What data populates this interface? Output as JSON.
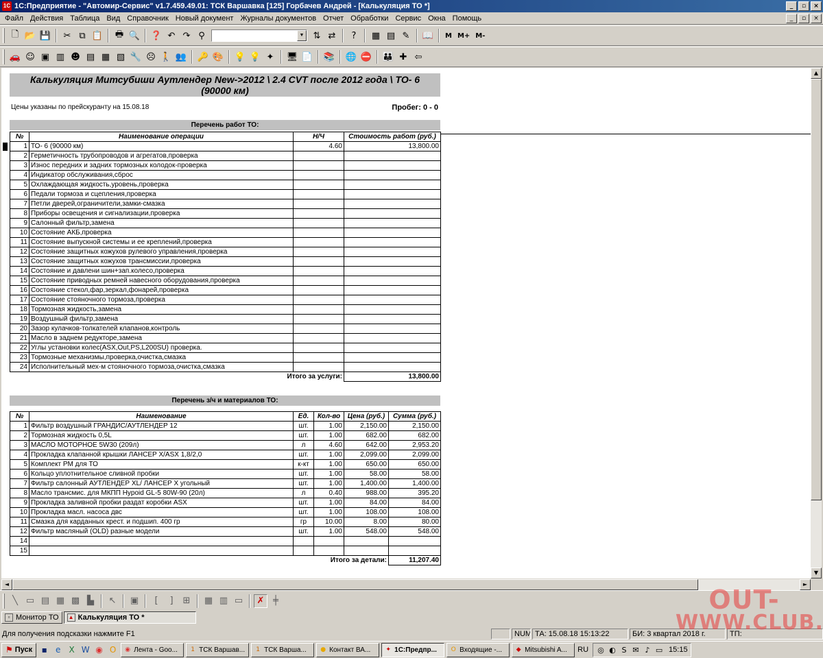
{
  "window": {
    "title": "1С:Предприятие - \"Автомир-Сервис\" v1.7.459.49.01: ТСК Варшавка [125] Горбачев Андрей - [Калькуляция ТО  *]",
    "minimize": "_",
    "restore": "▫",
    "close": "×"
  },
  "menu": [
    "Файл",
    "Действия",
    "Таблица",
    "Вид",
    "Справочник",
    "Новый документ",
    "Журналы документов",
    "Отчет",
    "Обработки",
    "Сервис",
    "Окна",
    "Помощь"
  ],
  "toolbar_text": {
    "m": "M",
    "m_plus": "M+",
    "m_minus": "M-"
  },
  "document": {
    "title_line1": "Калькуляция   Митсубиши Аутлендер  New->2012 \\ 2.4 CVT после 2012 года \\ ТО- 6",
    "title_line2": "(90000 км)",
    "price_note": "Цены указаны по прейскуранту на 15.08.18",
    "mileage": "Пробег: 0 - 0",
    "works": {
      "header": "Перечень работ ТО:",
      "columns": [
        "№",
        "Наименование операции",
        "Н/Ч",
        "Стоимость работ (руб.)"
      ],
      "rows": [
        {
          "n": "1",
          "name": "ТО- 6 (90000 км)",
          "hours": "4.60",
          "cost": "13,800.00"
        },
        {
          "n": "2",
          "name": "Герметичность трубопроводов и агрегатов,проверка",
          "hours": "",
          "cost": ""
        },
        {
          "n": "3",
          "name": "Износ передних и задних тормозных колодок-проверка",
          "hours": "",
          "cost": ""
        },
        {
          "n": "4",
          "name": "Индикатор обслуживания,сброс",
          "hours": "",
          "cost": ""
        },
        {
          "n": "5",
          "name": "Охлаждающая жидкость,уровень,проверка",
          "hours": "",
          "cost": ""
        },
        {
          "n": "6",
          "name": "Педали тормоза и сцепления,проверка",
          "hours": "",
          "cost": ""
        },
        {
          "n": "7",
          "name": "Петли дверей,ограничители,замки-смазка",
          "hours": "",
          "cost": ""
        },
        {
          "n": "8",
          "name": "Приборы освещения и сигнализации,проверка",
          "hours": "",
          "cost": ""
        },
        {
          "n": "9",
          "name": "Салонный фильтр,замена",
          "hours": "",
          "cost": ""
        },
        {
          "n": "10",
          "name": "Состояние АКБ,проверка",
          "hours": "",
          "cost": ""
        },
        {
          "n": "11",
          "name": "Состояние выпускной системы и ее креплений,проверка",
          "hours": "",
          "cost": ""
        },
        {
          "n": "12",
          "name": "Состояние защитных кожухов рулевого управления,проверка",
          "hours": "",
          "cost": ""
        },
        {
          "n": "13",
          "name": "Состояние защитных кожухов трансмиссии,проверка",
          "hours": "",
          "cost": ""
        },
        {
          "n": "14",
          "name": "Состояние и давлени шин+зап.колесо,проверка",
          "hours": "",
          "cost": ""
        },
        {
          "n": "15",
          "name": "Состояние приводных ремней навесного оборудования,проверка",
          "hours": "",
          "cost": ""
        },
        {
          "n": "16",
          "name": "Состояние стекол,фар,зеркал,фонарей,проверка",
          "hours": "",
          "cost": ""
        },
        {
          "n": "17",
          "name": "Состояние стояночного тормоза,проверка",
          "hours": "",
          "cost": ""
        },
        {
          "n": "18",
          "name": "Тормозная жидкость,замена",
          "hours": "",
          "cost": ""
        },
        {
          "n": "19",
          "name": "Воздушный фильтр,замена",
          "hours": "",
          "cost": ""
        },
        {
          "n": "20",
          "name": "Зазор кулачков-толкателей клапанов,контроль",
          "hours": "",
          "cost": ""
        },
        {
          "n": "21",
          "name": "Масло в заднем редукторе,замена",
          "hours": "",
          "cost": ""
        },
        {
          "n": "22",
          "name": "Углы установки колес(ASX,Out,PS,L200SU) проверка.",
          "hours": "",
          "cost": ""
        },
        {
          "n": "23",
          "name": "Тормозные механизмы,проверка,очистка,смазка",
          "hours": "",
          "cost": ""
        },
        {
          "n": "24",
          "name": "Исполнительный мех-м стояночного тормоза,очистка,смазка",
          "hours": "",
          "cost": ""
        }
      ],
      "total_label": "Итого за услуги:",
      "total_value": "13,800.00"
    },
    "parts": {
      "header": "Перечень з/ч и материалов ТО:",
      "columns": [
        "№",
        "Наименование",
        "Ед.",
        "Кол-во",
        "Цена (руб.)",
        "Сумма (руб.)"
      ],
      "rows": [
        {
          "n": "1",
          "name": "Фильтр воздушный ГРАНДИС/АУТЛЕНДЕР 12",
          "unit": "шт.",
          "qty": "1.00",
          "price": "2,150.00",
          "sum": "2,150.00"
        },
        {
          "n": "2",
          "name": "Тормозная жидкость 0,5L",
          "unit": "шт.",
          "qty": "1.00",
          "price": "682.00",
          "sum": "682.00"
        },
        {
          "n": "3",
          "name": "МАСЛО МОТОРНОЕ 5W30 (209л)",
          "unit": "л",
          "qty": "4.60",
          "price": "642.00",
          "sum": "2,953.20"
        },
        {
          "n": "4",
          "name": "Прокладка клапанной крышки ЛАНСЕР X/ASX 1,8/2,0",
          "unit": "шт.",
          "qty": "1.00",
          "price": "2,099.00",
          "sum": "2,099.00"
        },
        {
          "n": "5",
          "name": "Комплект РМ для ТО",
          "unit": "к-кт",
          "qty": "1.00",
          "price": "650.00",
          "sum": "650.00"
        },
        {
          "n": "6",
          "name": "Кольцо уплотнительное сливной пробки",
          "unit": "шт.",
          "qty": "1.00",
          "price": "58.00",
          "sum": "58.00"
        },
        {
          "n": "7",
          "name": "Фильтр салонный АУТЛЕНДЕР XL/ ЛАНСЕР X угольный",
          "unit": "шт.",
          "qty": "1.00",
          "price": "1,400.00",
          "sum": "1,400.00"
        },
        {
          "n": "8",
          "name": "Масло трансмис. для МКПП Hypoid GL-5 80W-90  (20л)",
          "unit": "л",
          "qty": "0.40",
          "price": "988.00",
          "sum": "395.20"
        },
        {
          "n": "9",
          "name": "Прокладка заливной пробки раздат коробки ASX",
          "unit": "шт.",
          "qty": "1.00",
          "price": "84.00",
          "sum": "84.00"
        },
        {
          "n": "10",
          "name": "Прокладка масл. насоса двс",
          "unit": "шт.",
          "qty": "1.00",
          "price": "108.00",
          "sum": "108.00"
        },
        {
          "n": "11",
          "name": "Смазка для карданных крест. и подшип. 400 гр",
          "unit": "гр",
          "qty": "10.00",
          "price": "8.00",
          "sum": "80.00"
        },
        {
          "n": "12",
          "name": "Фильтр масляный (OLD) разные модели",
          "unit": "шт.",
          "qty": "1.00",
          "price": "548.00",
          "sum": "548.00"
        },
        {
          "n": "14",
          "name": "",
          "unit": "",
          "qty": "",
          "price": "",
          "sum": ""
        },
        {
          "n": "15",
          "name": "",
          "unit": "",
          "qty": "",
          "price": "",
          "sum": ""
        }
      ],
      "total_label": "Итого за детали:",
      "total_value": "11,207.40"
    }
  },
  "mdi_tabs": [
    {
      "label": "Монитор ТО",
      "active": false
    },
    {
      "label": "Калькуляция ТО  *",
      "active": true
    }
  ],
  "status": {
    "hint": "Для получения подсказки нажмите F1",
    "num": "NUM",
    "ta": "ТА: 15.08.18  15:13:22",
    "bi": "БИ: 3 квартал 2018 г.",
    "tp": "ТП:"
  },
  "taskbar": {
    "start": "Пуск",
    "buttons": [
      {
        "label": "Лента - Goo...",
        "active": false
      },
      {
        "label": "ТСК Варшав...",
        "active": false
      },
      {
        "label": "ТСК Варша...",
        "active": false
      },
      {
        "label": "Контакт ВА...",
        "active": false
      },
      {
        "label": "1С:Предпр...",
        "active": true
      },
      {
        "label": "Входящие -...",
        "active": false
      },
      {
        "label": "Mitsubishi A...",
        "active": false
      }
    ],
    "lang": "RU",
    "clock": "15:15"
  },
  "watermark": {
    "line1": "OUT-",
    "line2": "WWW.",
    "line3": "CLUB.RU"
  }
}
